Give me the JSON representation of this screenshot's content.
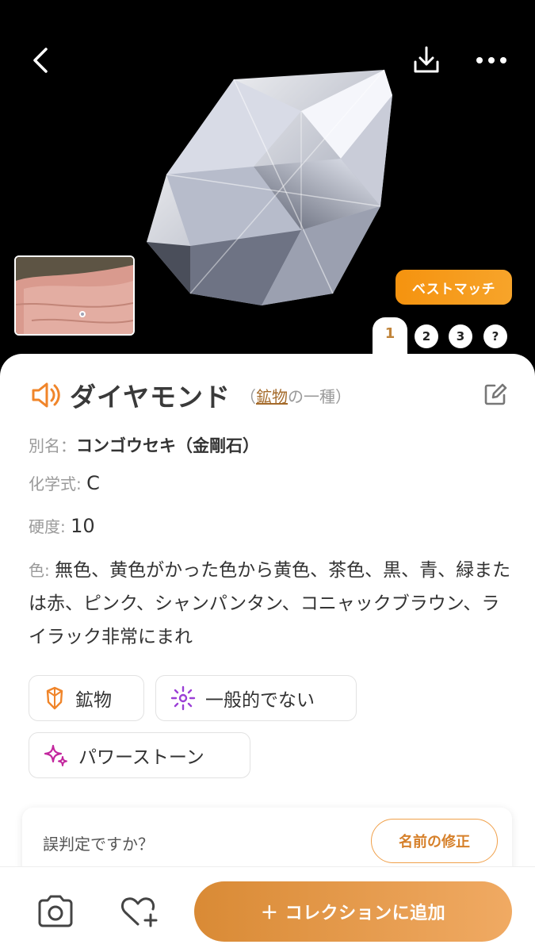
{
  "hero": {
    "best_match_label": "ベストマッチ",
    "pager": [
      "1",
      "2",
      "3",
      "?"
    ],
    "active_page": "1"
  },
  "card": {
    "name": "ダイヤモンド",
    "kind_prefix": "（",
    "kind_link": "鉱物",
    "kind_suffix": "の一種）",
    "alias_label": "別名：",
    "alias_value": "コンゴウセキ（金剛石）",
    "formula_label": "化学式: ",
    "formula_value": "C",
    "hardness_label": "硬度: ",
    "hardness_value": "10",
    "color_label": "色: ",
    "color_value": "無色、黄色がかった色から黄色、茶色、黒、青、緑または赤、ピンク、シャンパンタン、コニャックブラウン、ライラック非常にまれ",
    "tags": [
      {
        "label": "鉱物",
        "icon": "shield-gem-icon"
      },
      {
        "label": "一般的でない",
        "icon": "sparkle-burst-icon"
      },
      {
        "label": "パワーストーン",
        "icon": "sparkles-icon"
      }
    ],
    "misid_question": "誤判定ですか？",
    "fix_name_label": "名前の修正"
  },
  "bottom": {
    "add_collection_label": "＋ コレクションに追加"
  },
  "colors": {
    "accent_orange": "#f5930f",
    "brand_brown": "#a46a2a",
    "add_button": "#e09648"
  }
}
